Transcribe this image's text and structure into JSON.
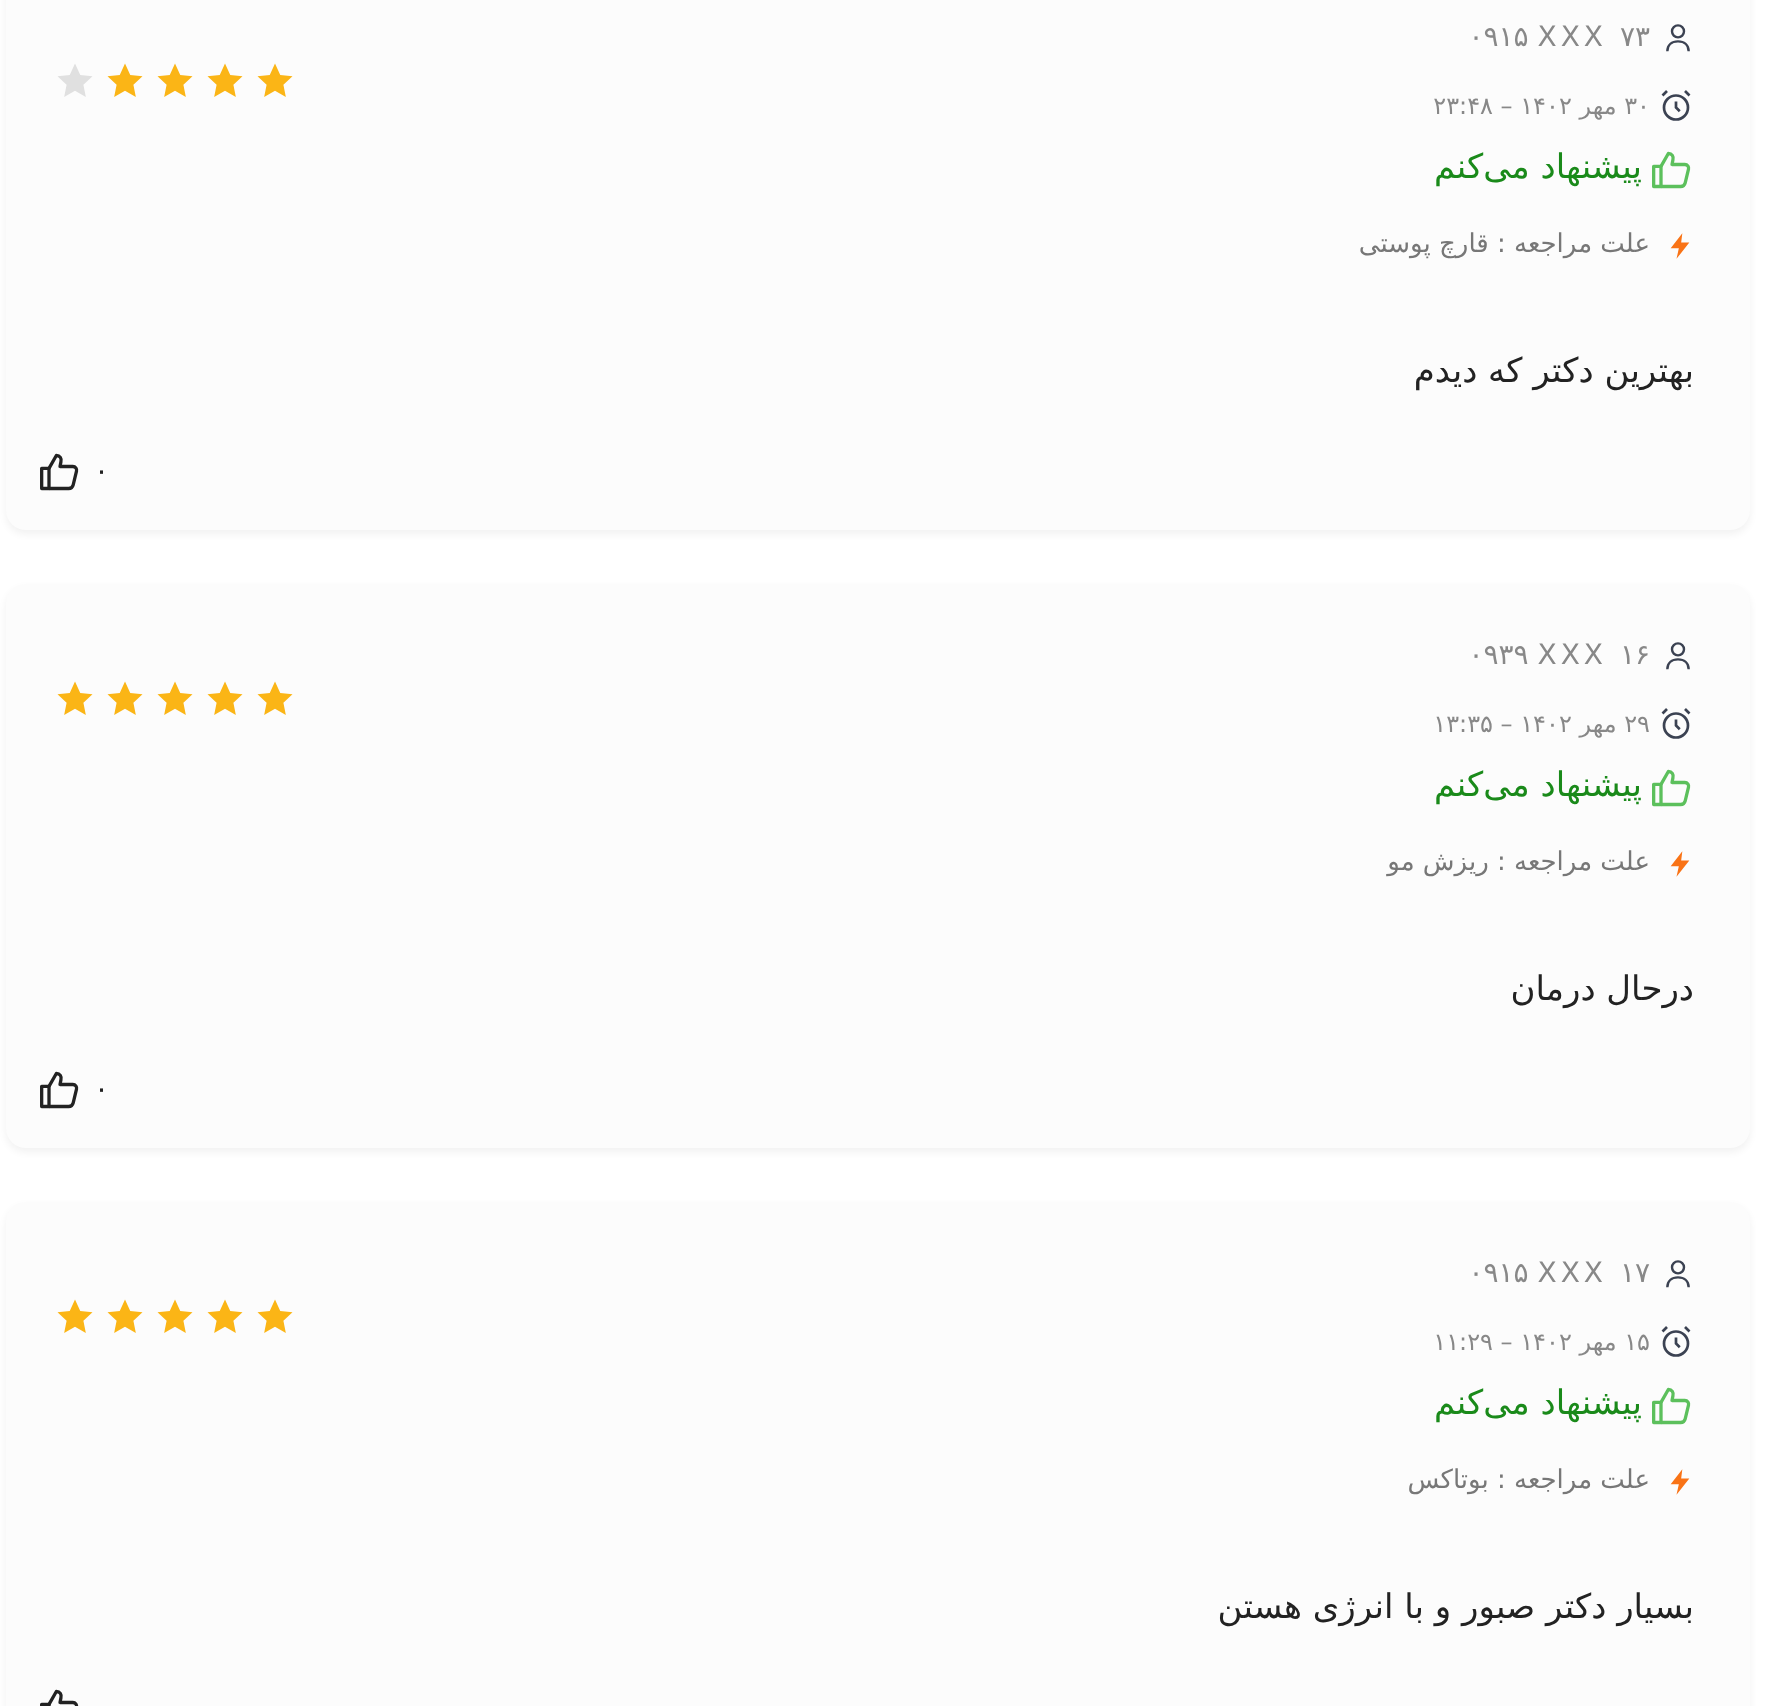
{
  "reviews": [
    {
      "phone": "۰۹۱۵ XXX ۷۳",
      "date": "۳۰ مهر ۱۴۰۲ – ۲۳:۴۸",
      "recommended": true,
      "recommend_label": "پیشنهاد می‌کنم",
      "reason": "علت مراجعه : قارچ پوستی",
      "stars": 4,
      "comment": "بهترین دکتر که دیدم",
      "likes": "۰"
    },
    {
      "phone": "۰۹۳۹ XXX ۱۶",
      "date": "۲۹ مهر ۱۴۰۲ – ۱۳:۳۵",
      "recommended": true,
      "recommend_label": "پیشنهاد می‌کنم",
      "reason": "علت مراجعه : ریزش مو",
      "stars": 5,
      "comment": "درحال درمان",
      "likes": "۰"
    },
    {
      "phone": "۰۹۱۵ XXX ۱۷",
      "date": "۱۵ مهر ۱۴۰۲ – ۱۱:۲۹",
      "recommended": true,
      "recommend_label": "پیشنهاد می‌کنم",
      "reason": "علت مراجعه : بوتاکس",
      "stars": 5,
      "comment": "بسیار دکتر صبور و با انرژی هستن"
    }
  ]
}
